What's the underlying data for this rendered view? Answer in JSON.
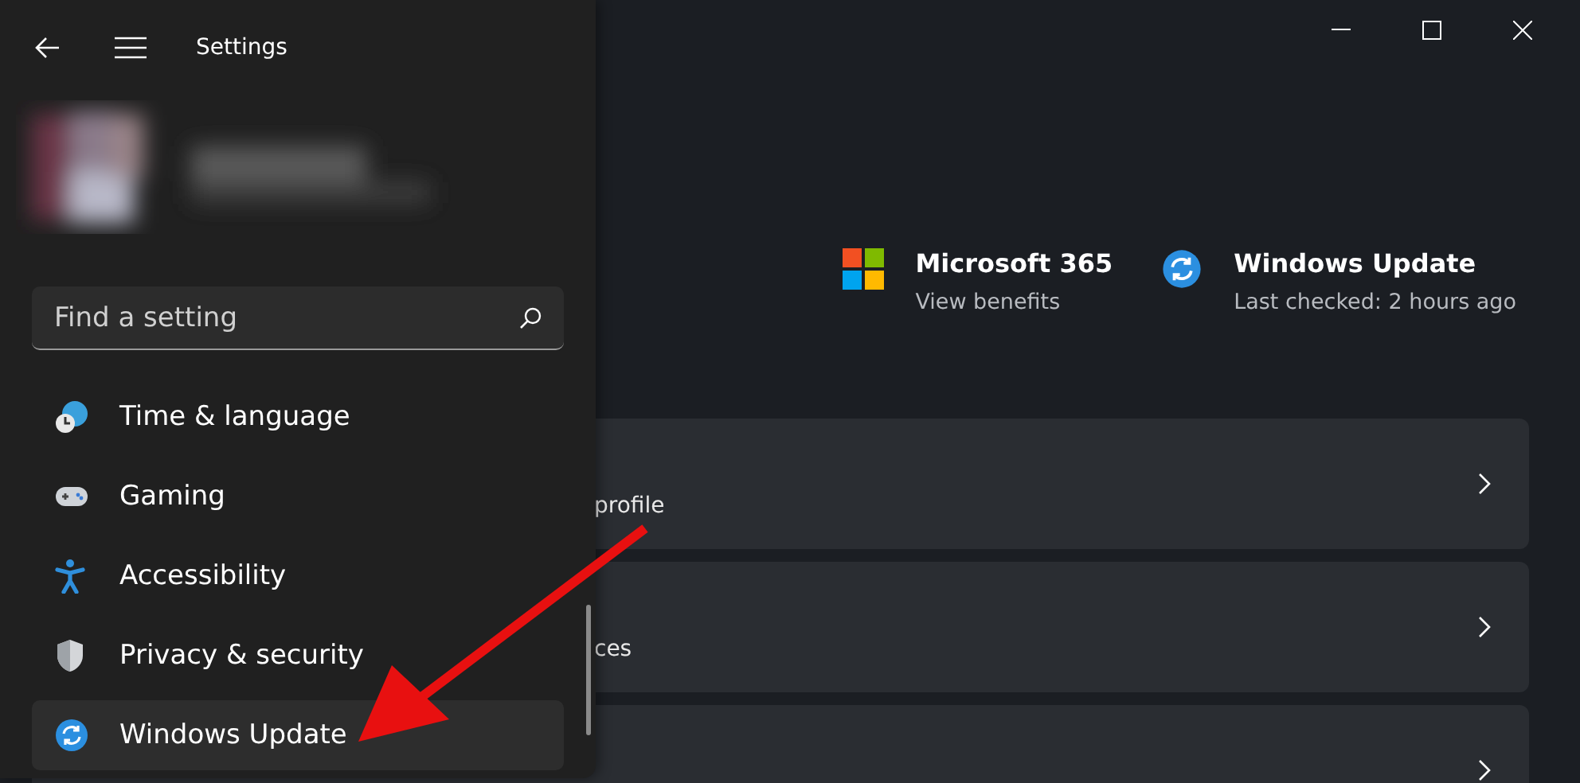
{
  "window": {
    "title": "Settings"
  },
  "search": {
    "placeholder": "Find a setting"
  },
  "nav_items": [
    {
      "label": "Time & language",
      "selected": false
    },
    {
      "label": "Gaming",
      "selected": false
    },
    {
      "label": "Accessibility",
      "selected": false
    },
    {
      "label": "Privacy & security",
      "selected": false
    },
    {
      "label": "Windows Update",
      "selected": true
    }
  ],
  "header_tiles": [
    {
      "title": "Microsoft 365",
      "subtitle": "View benefits"
    },
    {
      "title": "Windows Update",
      "subtitle": "Last checked: 2 hours ago"
    }
  ],
  "cards": [
    {
      "kind": "link",
      "text": "profile"
    },
    {
      "kind": "link",
      "text": "ces"
    },
    {
      "kind": "link"
    }
  ]
}
